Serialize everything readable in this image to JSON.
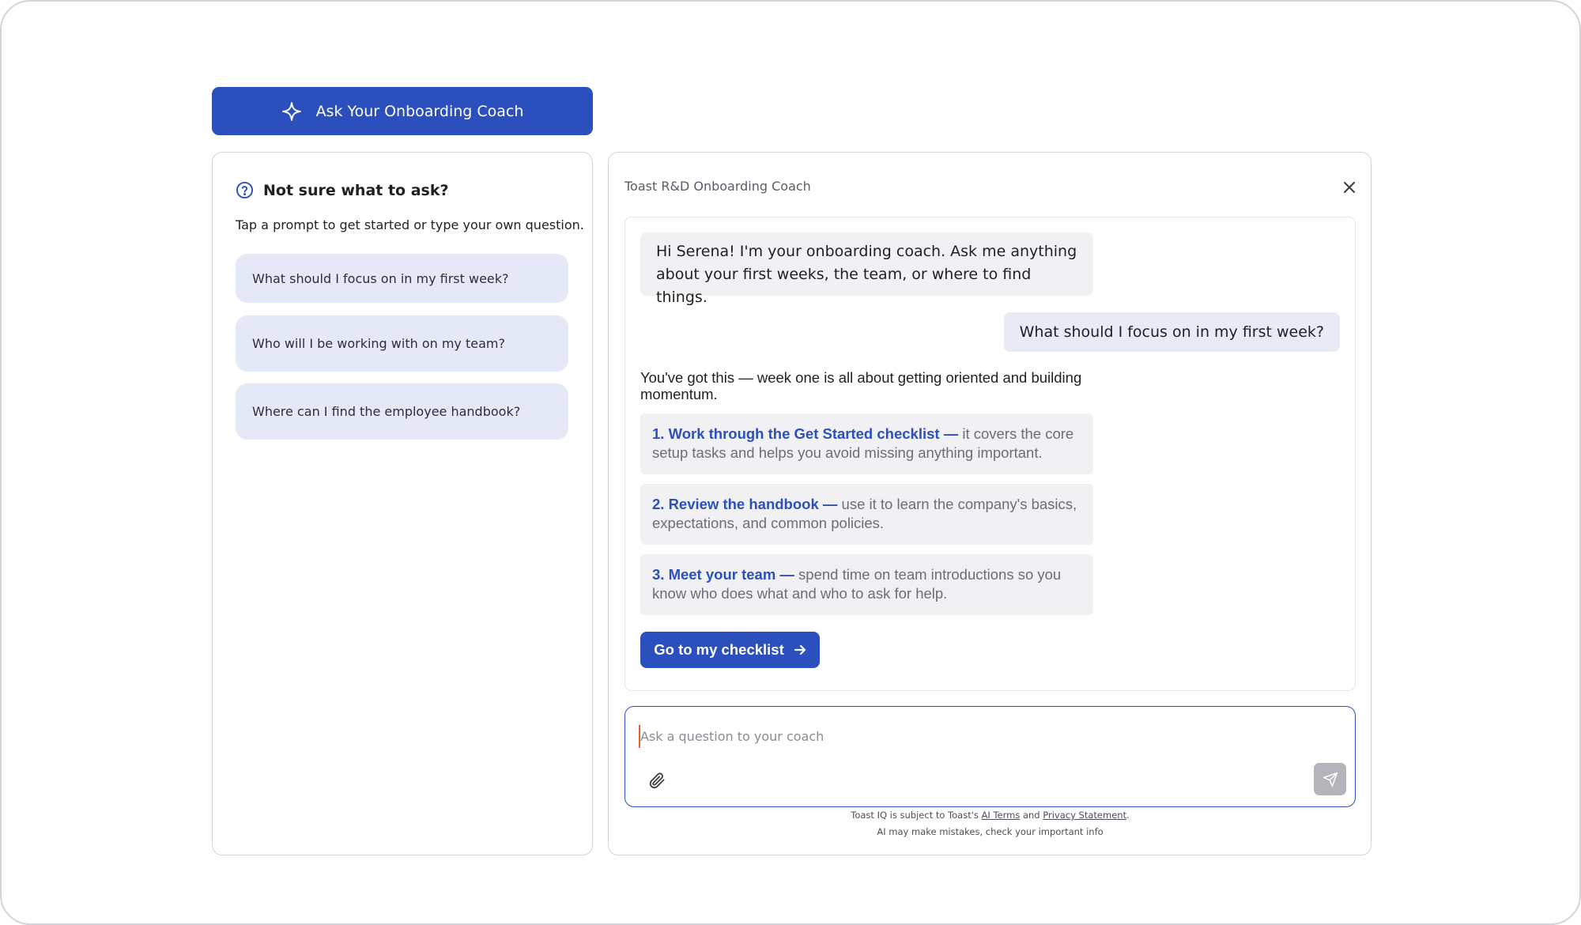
{
  "ask_button": {
    "label": "Ask Your Onboarding Coach",
    "icon": "sparkle-icon"
  },
  "prompts_panel": {
    "title": "Not sure what to ask?",
    "subtitle": "Tap a prompt to get started or type your own question.",
    "prompts": [
      "What should I focus on in my first week?",
      "Who will I be working with on my team?",
      "Where can I find the employee handbook?"
    ]
  },
  "chat": {
    "title": "Toast R&D Onboarding Coach",
    "greeting": "Hi Serena! I'm your onboarding coach. Ask me anything about your first weeks, the team, or where to find things.",
    "user_message": "What should I focus on in my first week?",
    "reply_intro": "You've got this — week one is all about getting oriented and building momentum.",
    "steps": [
      {
        "lead": "1. Work through the Get Started checklist —",
        "text": " it covers the core setup tasks and helps you avoid missing anything important."
      },
      {
        "lead": "2. Review the handbook —",
        "text": " use it to learn the company's basics, expectations, and common policies."
      },
      {
        "lead": "3. Meet your team —",
        "text": " spend time on team introductions so you know who does what and who to ask for help."
      }
    ],
    "cta_label": "Go to my checklist",
    "input_placeholder": "Ask a question to your coach",
    "disclaimer": {
      "prefix": "Toast IQ is subject to Toast's ",
      "ai_terms": "AI Terms",
      "and": " and ",
      "privacy": "Privacy Statement",
      "suffix": ".",
      "line2": "AI may make mistakes, check your important info"
    }
  },
  "colors": {
    "accent": "#2b50bd",
    "prompt_bg": "#e5e8f6",
    "bubble_bg": "#f1f1f3",
    "caret": "#e8602c"
  }
}
